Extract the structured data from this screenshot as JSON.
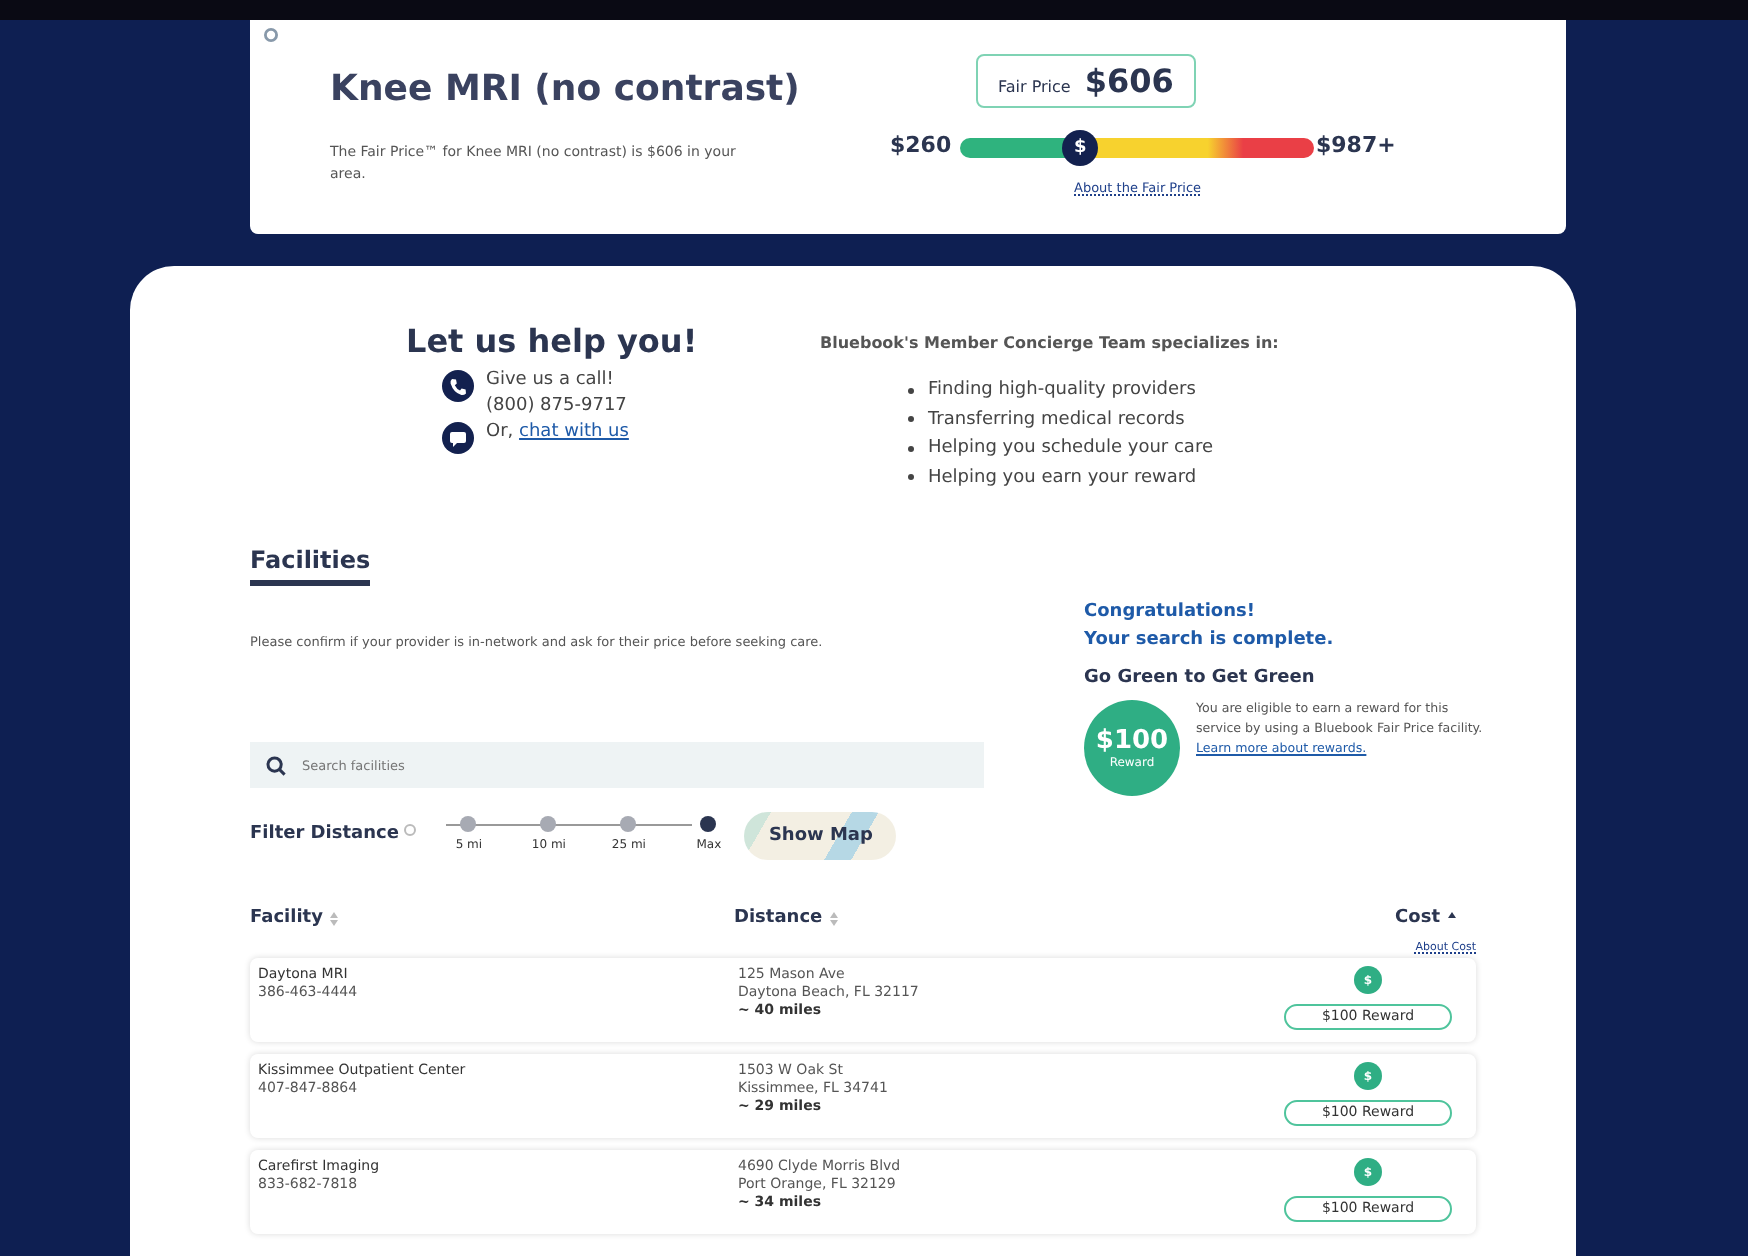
{
  "price_card": {
    "title": "Knee MRI (no contrast)",
    "description": "The Fair Price™ for Knee MRI (no contrast) is $606 in your area.",
    "fair_price_label": "Fair Price",
    "fair_price": "$606",
    "low": "$260",
    "high": "$987+",
    "marker": "$",
    "level": 0.34,
    "link": "About the Fair Price"
  },
  "help": {
    "title": "Let us help you!",
    "call_label": "Give us a call!",
    "phone": "(800) 875-9717",
    "chat_prefix": "Or,",
    "chat_link": "chat with us",
    "team_heading": "Bluebook's Member Concierge Team specializes in:",
    "services": [
      "Finding high-quality providers",
      "Transferring medical records",
      "Helping you schedule your care",
      "Helping you earn your reward"
    ]
  },
  "facilities": {
    "tab": "Facilities",
    "notice": "Please confirm if your provider is in-network and ask for their price before seeking care.",
    "search": {
      "placeholder": "Search facilities"
    },
    "filter_label": "Filter Distance",
    "distances": [
      {
        "label": "5 mi",
        "selected": false
      },
      {
        "label": "10 mi",
        "selected": false
      },
      {
        "label": "25 mi",
        "selected": false
      },
      {
        "label": "Max",
        "selected": true
      }
    ],
    "show_map": "Show Map",
    "reward": {
      "congrats": "Congratulations!",
      "complete": "Your search is complete.",
      "heading": "Go Green to Get Green",
      "amount": "$100",
      "amount_label": "Reward",
      "text": "You are eligible to earn a reward for this service by using a Bluebook Fair Price facility.",
      "link": "Learn more about rewards."
    },
    "columns": [
      {
        "label": "Facility",
        "sorted": false
      },
      {
        "label": "Distance",
        "sorted": false
      },
      {
        "label": "Cost",
        "sorted": true
      }
    ],
    "about_cost": "About Cost",
    "rows": [
      {
        "name": "Daytona MRI",
        "phone": "386-463-4444",
        "street": "125 Mason Ave",
        "city": "Daytona Beach, FL 32117",
        "distance": "~ 40 miles",
        "cost_symbol": "$",
        "reward": "$100 Reward"
      },
      {
        "name": "Kissimmee Outpatient Center",
        "phone": "407-847-8864",
        "street": "1503 W Oak St",
        "city": "Kissimmee, FL 34741",
        "distance": "~ 29 miles",
        "cost_symbol": "$",
        "reward": "$100 Reward"
      },
      {
        "name": "Carefirst Imaging",
        "phone": "833-682-7818",
        "street": "4690 Clyde Morris Blvd",
        "city": "Port Orange, FL 32129",
        "distance": "~ 34 miles",
        "cost_symbol": "$",
        "reward": "$100 Reward"
      }
    ]
  }
}
